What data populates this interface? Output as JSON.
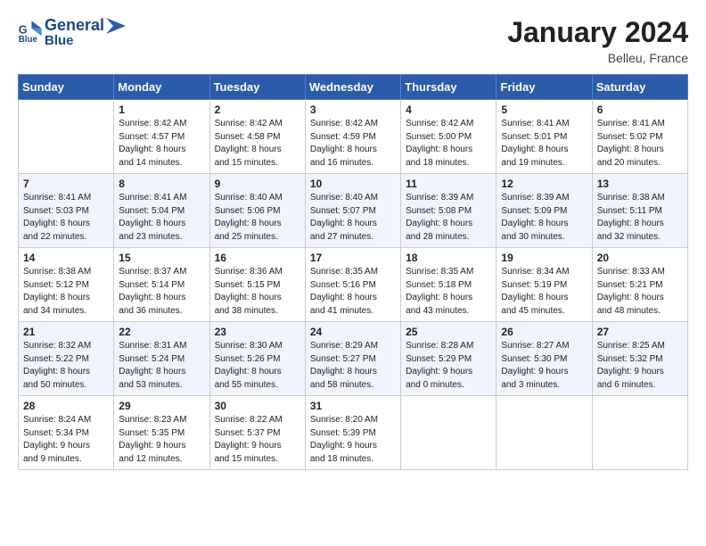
{
  "header": {
    "logo_line1": "General",
    "logo_line2": "Blue",
    "month_title": "January 2024",
    "location": "Belleu, France"
  },
  "days_of_week": [
    "Sunday",
    "Monday",
    "Tuesday",
    "Wednesday",
    "Thursday",
    "Friday",
    "Saturday"
  ],
  "weeks": [
    [
      {
        "day": "",
        "info": ""
      },
      {
        "day": "1",
        "info": "Sunrise: 8:42 AM\nSunset: 4:57 PM\nDaylight: 8 hours\nand 14 minutes."
      },
      {
        "day": "2",
        "info": "Sunrise: 8:42 AM\nSunset: 4:58 PM\nDaylight: 8 hours\nand 15 minutes."
      },
      {
        "day": "3",
        "info": "Sunrise: 8:42 AM\nSunset: 4:59 PM\nDaylight: 8 hours\nand 16 minutes."
      },
      {
        "day": "4",
        "info": "Sunrise: 8:42 AM\nSunset: 5:00 PM\nDaylight: 8 hours\nand 18 minutes."
      },
      {
        "day": "5",
        "info": "Sunrise: 8:41 AM\nSunset: 5:01 PM\nDaylight: 8 hours\nand 19 minutes."
      },
      {
        "day": "6",
        "info": "Sunrise: 8:41 AM\nSunset: 5:02 PM\nDaylight: 8 hours\nand 20 minutes."
      }
    ],
    [
      {
        "day": "7",
        "info": "Sunrise: 8:41 AM\nSunset: 5:03 PM\nDaylight: 8 hours\nand 22 minutes."
      },
      {
        "day": "8",
        "info": "Sunrise: 8:41 AM\nSunset: 5:04 PM\nDaylight: 8 hours\nand 23 minutes."
      },
      {
        "day": "9",
        "info": "Sunrise: 8:40 AM\nSunset: 5:06 PM\nDaylight: 8 hours\nand 25 minutes."
      },
      {
        "day": "10",
        "info": "Sunrise: 8:40 AM\nSunset: 5:07 PM\nDaylight: 8 hours\nand 27 minutes."
      },
      {
        "day": "11",
        "info": "Sunrise: 8:39 AM\nSunset: 5:08 PM\nDaylight: 8 hours\nand 28 minutes."
      },
      {
        "day": "12",
        "info": "Sunrise: 8:39 AM\nSunset: 5:09 PM\nDaylight: 8 hours\nand 30 minutes."
      },
      {
        "day": "13",
        "info": "Sunrise: 8:38 AM\nSunset: 5:11 PM\nDaylight: 8 hours\nand 32 minutes."
      }
    ],
    [
      {
        "day": "14",
        "info": "Sunrise: 8:38 AM\nSunset: 5:12 PM\nDaylight: 8 hours\nand 34 minutes."
      },
      {
        "day": "15",
        "info": "Sunrise: 8:37 AM\nSunset: 5:14 PM\nDaylight: 8 hours\nand 36 minutes."
      },
      {
        "day": "16",
        "info": "Sunrise: 8:36 AM\nSunset: 5:15 PM\nDaylight: 8 hours\nand 38 minutes."
      },
      {
        "day": "17",
        "info": "Sunrise: 8:35 AM\nSunset: 5:16 PM\nDaylight: 8 hours\nand 41 minutes."
      },
      {
        "day": "18",
        "info": "Sunrise: 8:35 AM\nSunset: 5:18 PM\nDaylight: 8 hours\nand 43 minutes."
      },
      {
        "day": "19",
        "info": "Sunrise: 8:34 AM\nSunset: 5:19 PM\nDaylight: 8 hours\nand 45 minutes."
      },
      {
        "day": "20",
        "info": "Sunrise: 8:33 AM\nSunset: 5:21 PM\nDaylight: 8 hours\nand 48 minutes."
      }
    ],
    [
      {
        "day": "21",
        "info": "Sunrise: 8:32 AM\nSunset: 5:22 PM\nDaylight: 8 hours\nand 50 minutes."
      },
      {
        "day": "22",
        "info": "Sunrise: 8:31 AM\nSunset: 5:24 PM\nDaylight: 8 hours\nand 53 minutes."
      },
      {
        "day": "23",
        "info": "Sunrise: 8:30 AM\nSunset: 5:26 PM\nDaylight: 8 hours\nand 55 minutes."
      },
      {
        "day": "24",
        "info": "Sunrise: 8:29 AM\nSunset: 5:27 PM\nDaylight: 8 hours\nand 58 minutes."
      },
      {
        "day": "25",
        "info": "Sunrise: 8:28 AM\nSunset: 5:29 PM\nDaylight: 9 hours\nand 0 minutes."
      },
      {
        "day": "26",
        "info": "Sunrise: 8:27 AM\nSunset: 5:30 PM\nDaylight: 9 hours\nand 3 minutes."
      },
      {
        "day": "27",
        "info": "Sunrise: 8:25 AM\nSunset: 5:32 PM\nDaylight: 9 hours\nand 6 minutes."
      }
    ],
    [
      {
        "day": "28",
        "info": "Sunrise: 8:24 AM\nSunset: 5:34 PM\nDaylight: 9 hours\nand 9 minutes."
      },
      {
        "day": "29",
        "info": "Sunrise: 8:23 AM\nSunset: 5:35 PM\nDaylight: 9 hours\nand 12 minutes."
      },
      {
        "day": "30",
        "info": "Sunrise: 8:22 AM\nSunset: 5:37 PM\nDaylight: 9 hours\nand 15 minutes."
      },
      {
        "day": "31",
        "info": "Sunrise: 8:20 AM\nSunset: 5:39 PM\nDaylight: 9 hours\nand 18 minutes."
      },
      {
        "day": "",
        "info": ""
      },
      {
        "day": "",
        "info": ""
      },
      {
        "day": "",
        "info": ""
      }
    ]
  ]
}
